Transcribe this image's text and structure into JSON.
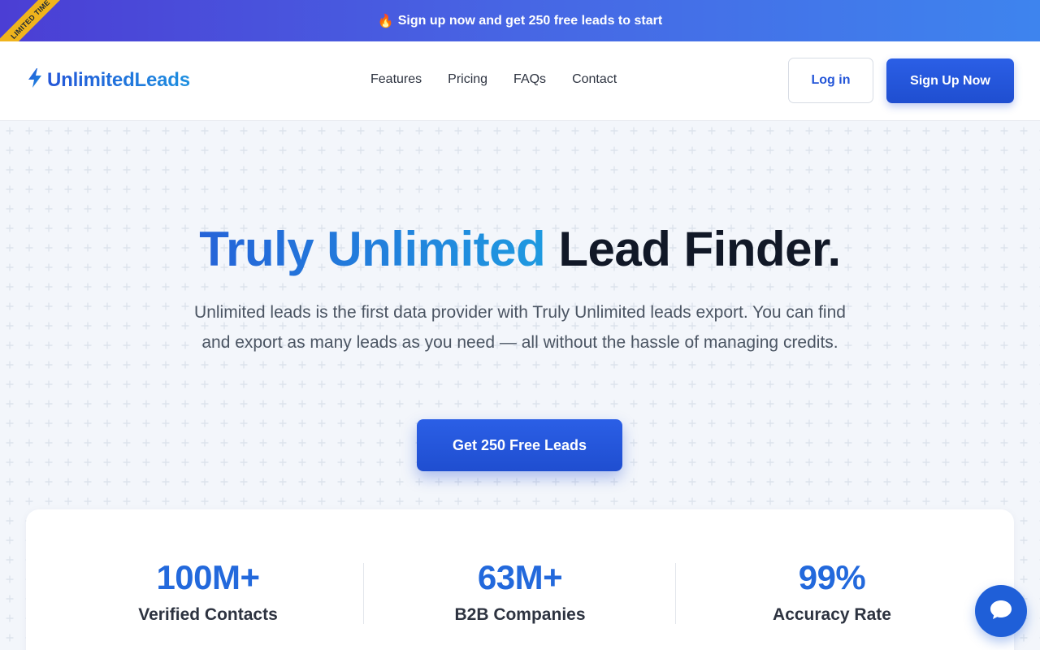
{
  "promo": {
    "ribbon": "LIMITED TIME",
    "icon": "fire-icon",
    "fire": "🔥",
    "text": "Sign up now and get 250 free leads to start"
  },
  "header": {
    "logo_icon": "lightning-bolt-icon",
    "logo_text": "UnlimitedLeads",
    "nav": [
      "Features",
      "Pricing",
      "FAQs",
      "Contact"
    ],
    "login_label": "Log in",
    "signup_label": "Sign Up Now"
  },
  "hero": {
    "headline_blue": "Truly Unlimited",
    "headline_dark": "Lead Finder.",
    "subtext": "Unlimited leads is the first data provider with Truly Unlimited leads export. You can find and export as many leads as you need — all without the hassle of managing credits.",
    "cta_label": "Get 250 Free Leads"
  },
  "stats": [
    {
      "value": "100M+",
      "label": "Verified Contacts"
    },
    {
      "value": "63M+",
      "label": "B2B Companies"
    },
    {
      "value": "99%",
      "label": "Accuracy Rate"
    }
  ],
  "chat": {
    "icon": "chat-bubble-icon"
  },
  "colors": {
    "brand_blue": "#2456d8",
    "accent_light_blue": "#1f9ae0",
    "ribbon_yellow": "#f0b41c",
    "page_bg": "#f3f6fb"
  }
}
